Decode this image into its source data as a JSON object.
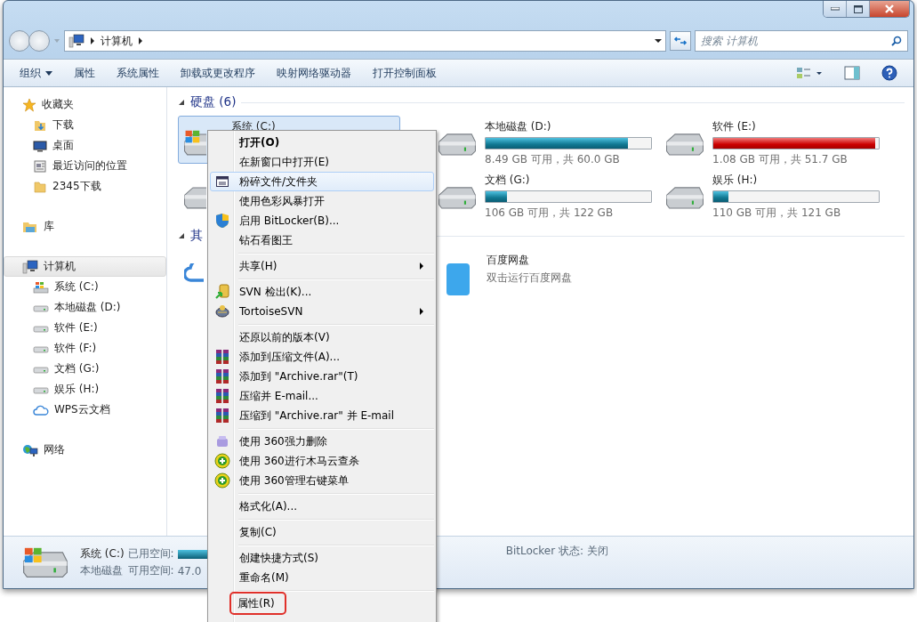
{
  "address": {
    "crumbs": [
      "计算机"
    ]
  },
  "search": {
    "placeholder": "搜索 计算机"
  },
  "toolbar": [
    {
      "label": "组织",
      "dropdown": true
    },
    {
      "label": "属性",
      "dropdown": false
    },
    {
      "label": "系统属性",
      "dropdown": false
    },
    {
      "label": "卸载或更改程序",
      "dropdown": false
    },
    {
      "label": "映射网络驱动器",
      "dropdown": false
    },
    {
      "label": "打开控制面板",
      "dropdown": false
    }
  ],
  "sidebar": [
    {
      "label": "收藏夹",
      "kind": "star",
      "selected": false,
      "children": [
        {
          "label": "下载",
          "kind": "download",
          "selected": false
        },
        {
          "label": "桌面",
          "kind": "desktop",
          "selected": false
        },
        {
          "label": "最近访问的位置",
          "kind": "recent",
          "selected": false
        },
        {
          "label": "2345下载",
          "kind": "folder",
          "selected": false
        }
      ]
    },
    {
      "label": "库",
      "kind": "library",
      "selected": false
    },
    {
      "label": "计算机",
      "kind": "computer",
      "selected": true,
      "children": [
        {
          "label": "系统 (C:)",
          "kind": "system-drive",
          "selected": false
        },
        {
          "label": "本地磁盘 (D:)",
          "kind": "drive",
          "selected": false
        },
        {
          "label": "软件 (E:)",
          "kind": "drive",
          "selected": false
        },
        {
          "label": "软件 (F:)",
          "kind": "drive",
          "selected": false
        },
        {
          "label": "文档 (G:)",
          "kind": "drive",
          "selected": false
        },
        {
          "label": "娱乐 (H:)",
          "kind": "drive",
          "selected": false
        },
        {
          "label": "WPS云文档",
          "kind": "cloud",
          "selected": false
        }
      ]
    },
    {
      "label": "网络",
      "kind": "network",
      "selected": false
    }
  ],
  "sections": [
    {
      "title": "硬盘 (6)",
      "expanded": true,
      "tiles": [
        {
          "kind": "system-drive",
          "name": "系统 (C:)",
          "selected": true
        },
        {
          "kind": "drive",
          "name": "本地磁盘 (D:)",
          "selected": false,
          "level": 0.86,
          "low_space": false,
          "info": "8.49 GB 可用，共 60.0 GB"
        },
        {
          "kind": "drive",
          "name": "软件 (E:)",
          "selected": false,
          "level": 0.98,
          "low_space": true,
          "info": "1.08 GB 可用，共 51.7 GB"
        },
        {
          "kind": "drive",
          "selected": false
        },
        {
          "kind": "drive",
          "name": "文档 (G:)",
          "selected": false,
          "level": 0.13,
          "low_space": false,
          "info": "106 GB 可用，共 122 GB"
        },
        {
          "kind": "drive",
          "name": "娱乐 (H:)",
          "selected": false,
          "level": 0.09,
          "low_space": false,
          "info": "110 GB 可用，共 121 GB"
        }
      ]
    },
    {
      "title": "其",
      "expanded": true,
      "tiles": [
        {
          "kind": "cloud",
          "selected": false
        },
        {
          "kind": "baidu",
          "name": "百度网盘",
          "selected": false,
          "info": "双击运行百度网盘"
        }
      ]
    }
  ],
  "details": {
    "name": "系统 (C:)",
    "type": "本地磁盘",
    "used_label": "已用空间:",
    "free_label": "可用空间:",
    "free_value": "47.0",
    "bitlocker": "BitLocker 状态: 关闭"
  },
  "context_menu": [
    [
      {
        "kind": "plain",
        "label": "打开(O)",
        "default": true,
        "hovered": false
      },
      {
        "kind": "plain",
        "label": "在新窗口中打开(E)",
        "hovered": false
      },
      {
        "kind": "shred",
        "label": "粉碎文件/文件夹",
        "hovered": true
      },
      {
        "kind": "plain",
        "label": "使用色彩风暴打开",
        "hovered": false
      },
      {
        "kind": "shield",
        "label": "启用 BitLocker(B)...",
        "hovered": false
      },
      {
        "kind": "plain",
        "label": "钻石看图王",
        "hovered": false
      }
    ],
    [
      {
        "kind": "plain",
        "label": "共享(H)",
        "submenu": true,
        "hovered": false
      }
    ],
    [
      {
        "kind": "svn",
        "label": "SVN 检出(K)...",
        "hovered": false
      },
      {
        "kind": "tortoise",
        "label": "TortoiseSVN",
        "submenu": true,
        "hovered": false
      }
    ],
    [
      {
        "kind": "plain",
        "label": "还原以前的版本(V)",
        "hovered": false
      },
      {
        "kind": "rar",
        "label": "添加到压缩文件(A)...",
        "hovered": false
      },
      {
        "kind": "rar",
        "label": "添加到 \"Archive.rar\"(T)",
        "hovered": false
      },
      {
        "kind": "rar",
        "label": "压缩并 E-mail...",
        "hovered": false
      },
      {
        "kind": "rar",
        "label": "压缩到 \"Archive.rar\" 并 E-mail",
        "hovered": false
      }
    ],
    [
      {
        "kind": "eraser",
        "label": "使用 360强力删除",
        "hovered": false
      },
      {
        "kind": "plus",
        "label": "使用 360进行木马云查杀",
        "hovered": false
      },
      {
        "kind": "plus",
        "label": "使用 360管理右键菜单",
        "hovered": false
      }
    ],
    [
      {
        "kind": "plain",
        "label": "格式化(A)...",
        "hovered": false
      }
    ],
    [
      {
        "kind": "plain",
        "label": "复制(C)",
        "hovered": false
      }
    ],
    [
      {
        "kind": "plain",
        "label": "创建快捷方式(S)",
        "hovered": false
      },
      {
        "kind": "plain",
        "label": "重命名(M)",
        "hovered": false
      }
    ],
    [
      {
        "kind": "plain",
        "label": "属性(R)",
        "hovered": false,
        "outlined": true
      }
    ]
  ]
}
